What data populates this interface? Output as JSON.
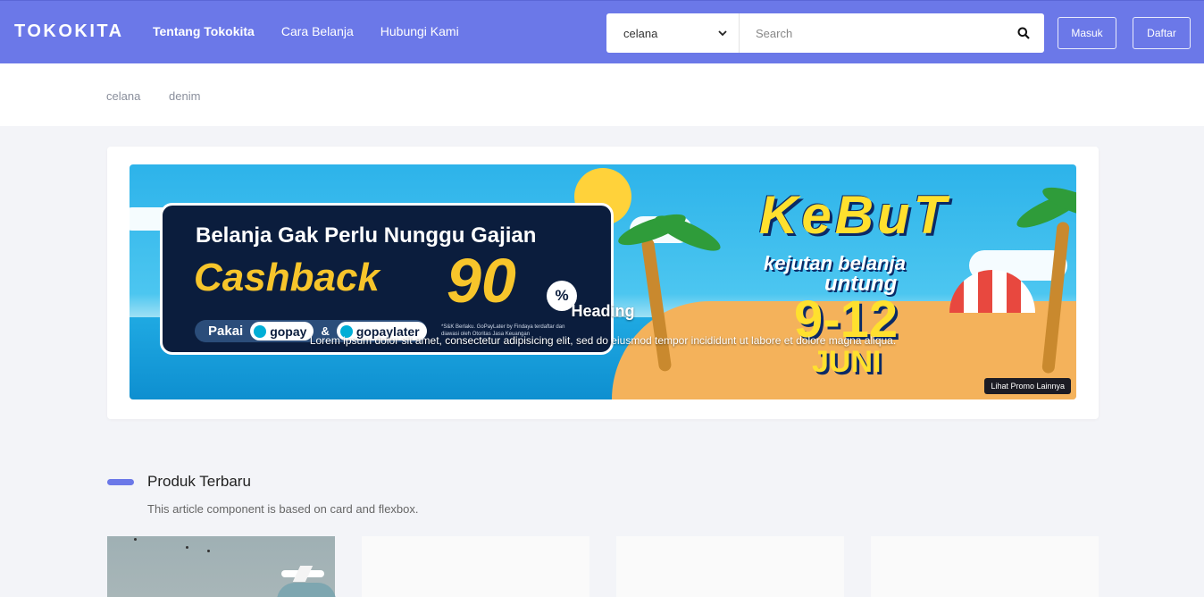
{
  "navbar": {
    "brand": "TOKOKITA",
    "links": [
      "Tentang Tokokita",
      "Cara Belanja",
      "Hubungi Kami"
    ],
    "search": {
      "category": "celana",
      "placeholder": "Search"
    },
    "login_label": "Masuk",
    "register_label": "Daftar",
    "accent_color": "#6b78e8"
  },
  "tags": [
    "celana",
    "denim"
  ],
  "carousel": {
    "banner": {
      "line1": "Belanja Gak Perlu Nunggu Gajian",
      "cashback": "Cashback",
      "amount": "90",
      "percent": "%",
      "pakai": "Pakai",
      "gopay": "gopay",
      "amp": "&",
      "gopaylater": "gopaylater",
      "fine_print": "*S&K Berlaku. GoPayLater by Findaya terdaftar dan diawasi oleh Otoritas Jasa Keuangan",
      "kebut": "KeBuT",
      "kejutan": "kejutan belanja",
      "untung": "untung",
      "dates": "9-12",
      "month": "JUNI",
      "more_label": "Lihat Promo Lainnya"
    },
    "caption_heading": "Heading",
    "caption_text": "Lorem ipsum dolor sit amet, consectetur adipisicing elit, sed do eiusmod tempor incididunt ut labore et dolore magna aliqua."
  },
  "section": {
    "title": "Produk Terbaru",
    "subtitle": "This article component is based on card and flexbox."
  },
  "icons": {
    "search": "search-icon",
    "dropdown": "chevron-down-icon"
  }
}
